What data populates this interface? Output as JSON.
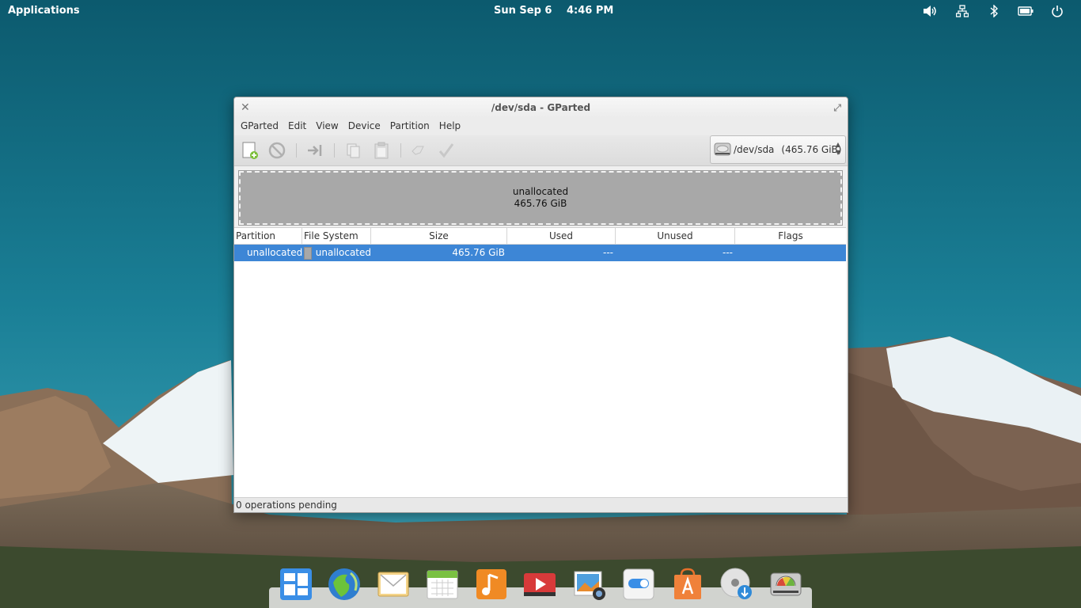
{
  "top_panel": {
    "applications": "Applications",
    "date": "Sun Sep  6",
    "time": "4:46 PM",
    "indicators": [
      "volume-icon",
      "network-icon",
      "bluetooth-icon",
      "battery-icon",
      "power-icon"
    ]
  },
  "window": {
    "title": "/dev/sda - GParted",
    "menu": [
      "GParted",
      "Edit",
      "View",
      "Device",
      "Partition",
      "Help"
    ],
    "toolbar": [
      "new-partition-icon",
      "delete-icon",
      "resize-move-icon",
      "copy-icon",
      "paste-icon",
      "undo-icon",
      "apply-icon"
    ],
    "device": {
      "name": "/dev/sda",
      "size": "(465.76 GiB)"
    },
    "graph": {
      "label": "unallocated",
      "size": "465.76 GiB"
    },
    "table": {
      "columns": [
        "Partition",
        "File System",
        "Size",
        "Used",
        "Unused",
        "Flags"
      ],
      "rows": [
        {
          "partition": "unallocated",
          "filesystem": "unallocated",
          "size": "465.76 GiB",
          "used": "---",
          "unused": "---",
          "flags": ""
        }
      ]
    },
    "status": "0 operations pending"
  },
  "dock": {
    "items": [
      "multitasking-view-icon",
      "web-browser-icon",
      "mail-icon",
      "calendar-icon",
      "music-icon",
      "videos-icon",
      "photos-icon",
      "system-settings-icon",
      "app-center-icon",
      "disk-installer-icon",
      "gparted-icon"
    ]
  },
  "colors": {
    "selection": "#3d86d6",
    "sky": "#17788f",
    "unallocated": "#a8a8a8"
  }
}
